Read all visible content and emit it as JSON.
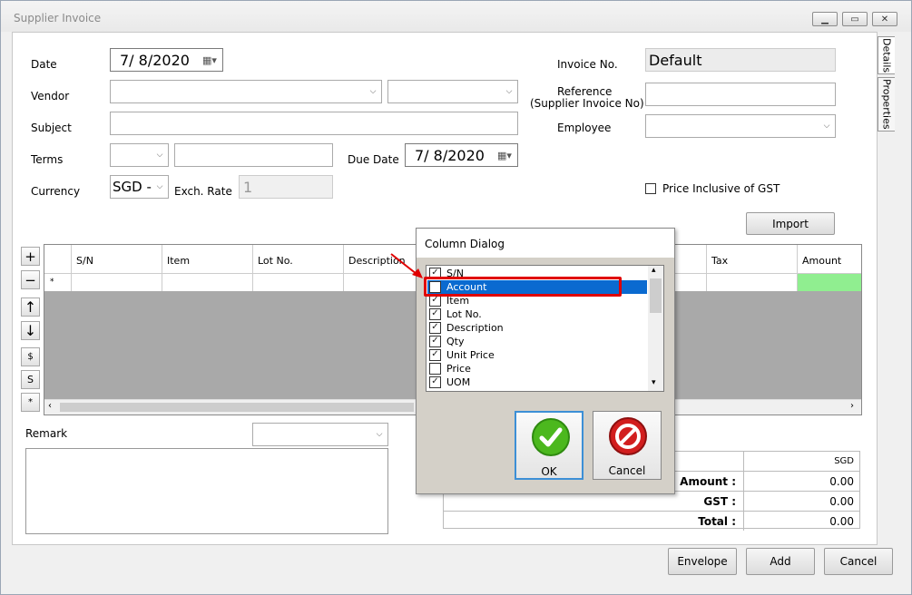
{
  "window": {
    "title": "Supplier Invoice"
  },
  "labels": {
    "date": "Date",
    "vendor": "Vendor",
    "subject": "Subject",
    "terms": "Terms",
    "currency": "Currency",
    "exch_rate": "Exch. Rate",
    "due_date": "Due Date",
    "invoice_no": "Invoice No.",
    "reference_line1": "Reference",
    "reference_line2": "(Supplier Invoice No)",
    "employee": "Employee",
    "price_inclusive": "Price Inclusive of GST",
    "remark": "Remark"
  },
  "fields": {
    "date_value": "7/  8/2020",
    "due_date_value": "7/  8/2020",
    "currency_value": "SGD -",
    "exch_rate_value": "1",
    "invoice_no_value": "Default"
  },
  "buttons": {
    "import": "Import",
    "envelope": "Envelope",
    "add": "Add",
    "cancel": "Cancel",
    "ok": "OK",
    "dialog_cancel": "Cancel"
  },
  "tabs": {
    "details": "Details",
    "properties": "Properties"
  },
  "grid": {
    "columns": [
      "S/N",
      "Item",
      "Lot No.",
      "Description",
      "Tax",
      "Amount"
    ],
    "new_row_marker": "*"
  },
  "side_buttons": [
    "+",
    "−",
    "↑",
    "↓",
    "$",
    "S",
    "*"
  ],
  "totals": {
    "currency": "SGD",
    "rows": [
      {
        "label": "Amount :",
        "value": "0.00"
      },
      {
        "label": "GST :",
        "value": "0.00"
      },
      {
        "label": "Total :",
        "value": "0.00"
      }
    ]
  },
  "column_dialog": {
    "title": "Column Dialog",
    "items": [
      {
        "label": "S/N",
        "checked": true
      },
      {
        "label": "Account",
        "checked": false,
        "selected": true
      },
      {
        "label": "Item",
        "checked": true
      },
      {
        "label": "Lot No.",
        "checked": true
      },
      {
        "label": "Description",
        "checked": true
      },
      {
        "label": "Qty",
        "checked": true
      },
      {
        "label": "Unit Price",
        "checked": true
      },
      {
        "label": "Price",
        "checked": false
      },
      {
        "label": "UOM",
        "checked": true
      }
    ]
  },
  "colors": {
    "highlight": "#e00000",
    "selection": "#0a6ad0",
    "amount_cell": "#90ee90"
  }
}
